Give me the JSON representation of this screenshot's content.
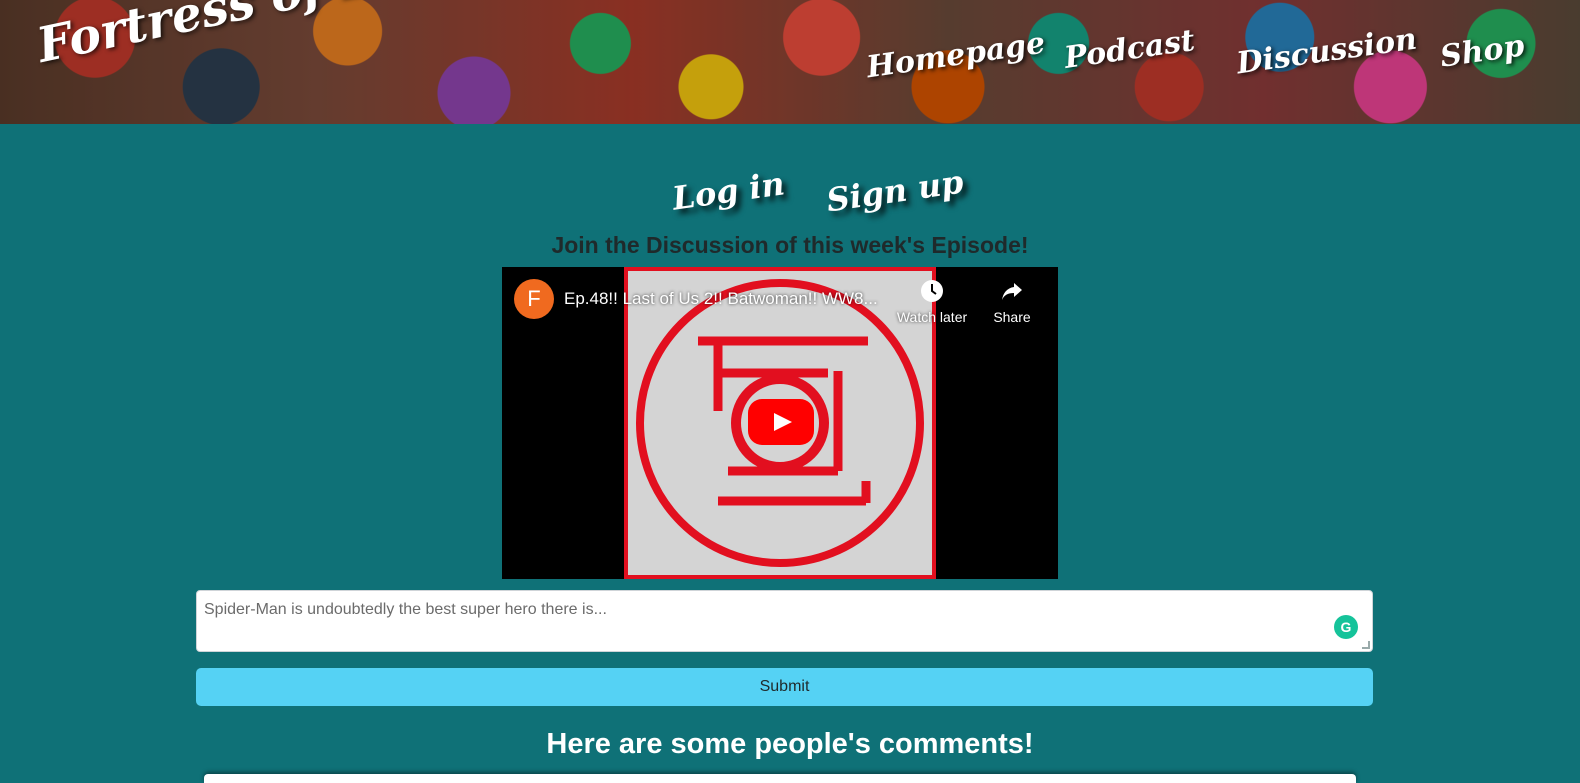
{
  "header": {
    "brand": "Fortress of Fandom",
    "nav": [
      "Homepage",
      "Podcast",
      "Discussion",
      "Shop"
    ]
  },
  "auth": {
    "login": "Log in",
    "signup": "Sign up"
  },
  "discussion": {
    "heading": "Join the Discussion of this week's Episode!"
  },
  "video": {
    "channel_initial": "F",
    "title": "Ep.48!! Last of Us 2!! Batwoman!! WW8...",
    "watch_later": "Watch later",
    "share": "Share",
    "play_icon": "play-icon"
  },
  "comment": {
    "placeholder": "Spider-Man is undoubtedly the best super hero there is...",
    "submit": "Submit",
    "grammarly_icon": "grammarly-icon"
  },
  "comments_section": {
    "heading": "Here are some people's comments!"
  },
  "colors": {
    "page_bg": "#0f7177",
    "submit_bg": "#55d2f4",
    "play_red": "#ff0000",
    "thumb_red": "#e20f1f"
  }
}
